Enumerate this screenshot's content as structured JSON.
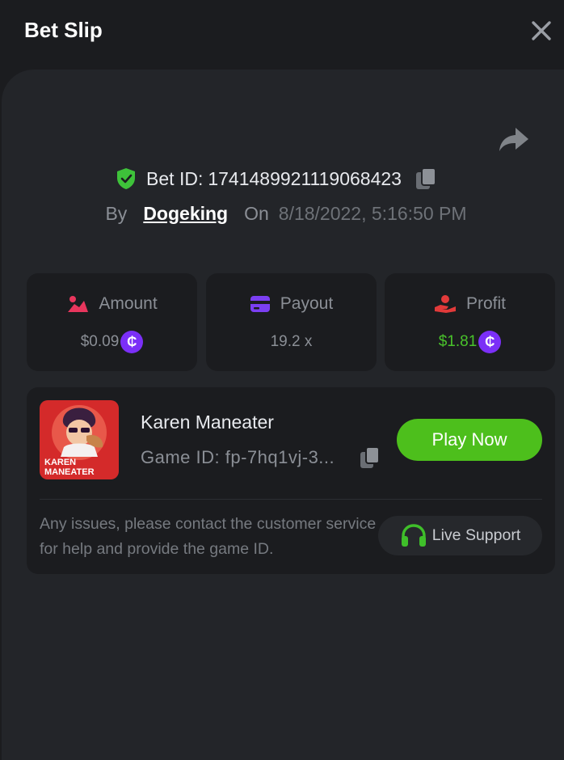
{
  "header": {
    "title": "Bet Slip"
  },
  "bet": {
    "id_label": "Bet ID:",
    "id_value": "1741489921119068423",
    "by_label": "By",
    "username": "Dogeking",
    "on_label": "On",
    "date": "8/18/2022, 5:16:50 PM"
  },
  "stats": {
    "amount": {
      "label": "Amount",
      "value": "$0.09"
    },
    "payout": {
      "label": "Payout",
      "value": "19.2 x"
    },
    "profit": {
      "label": "Profit",
      "value": "$1.81"
    },
    "coin_symbol": "₵"
  },
  "game": {
    "name": "Karen Maneater",
    "id_text": "Game ID: fp-7hq1vj-3...",
    "thumb_text_line1": "KAREN",
    "thumb_text_line2": "MANEATER",
    "play_label": "Play Now"
  },
  "support": {
    "message": "Any issues, please contact the customer service for help and provide the game ID.",
    "button_label": "Live Support"
  },
  "icons": [
    "close-icon",
    "share-icon",
    "verified-shield-icon",
    "copy-icon",
    "amount-icon",
    "payout-card-icon",
    "profit-hand-icon",
    "coin-icon",
    "headset-icon"
  ],
  "colors": {
    "accent_green": "#4dbf1c",
    "profit_green": "#49c22b",
    "coin_purple": "#7b2ff7",
    "amount_pink": "#e8365d",
    "profit_red": "#e23a3a"
  }
}
